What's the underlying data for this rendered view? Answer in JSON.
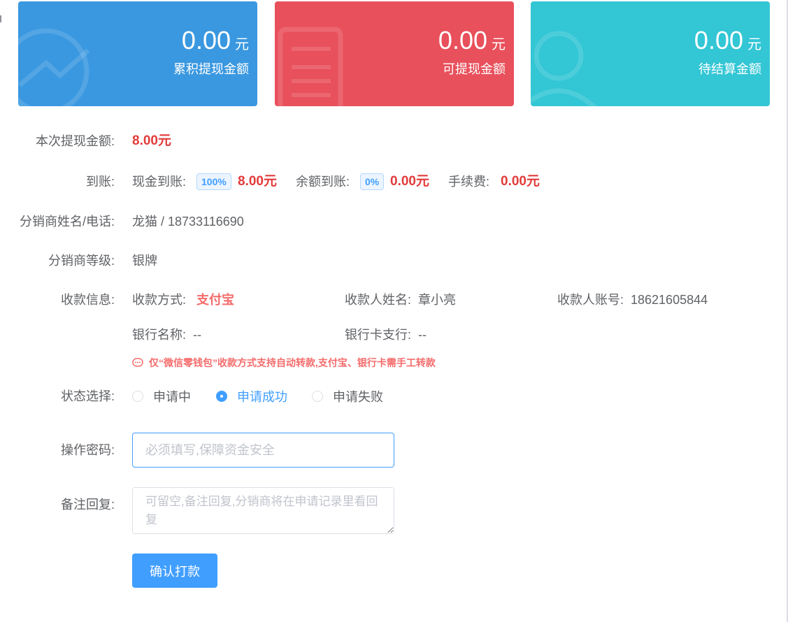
{
  "colors": {
    "card_blue": "#3a98e0",
    "card_red": "#e8505b",
    "card_cyan": "#33c6d5",
    "accent": "#409eff",
    "danger": "#e23b3b"
  },
  "stats": [
    {
      "amount": "0.00",
      "unit": "元",
      "label": "累积提现金额",
      "icon": "chart-trend-icon"
    },
    {
      "amount": "0.00",
      "unit": "元",
      "label": "可提现金额",
      "icon": "document-icon"
    },
    {
      "amount": "0.00",
      "unit": "元",
      "label": "待结算金额",
      "icon": "user-icon"
    }
  ],
  "form": {
    "amount": {
      "label": "本次提现金额:",
      "value": "8.00元"
    },
    "arrival": {
      "label": "到账:",
      "cash_label": "现金到账:",
      "cash_pct": "100%",
      "cash_value": "8.00元",
      "balance_label": "余额到账:",
      "balance_pct": "0%",
      "balance_value": "0.00元",
      "fee_label": "手续费:",
      "fee_value": "0.00元"
    },
    "distributor": {
      "label": "分销商姓名/电话:",
      "value": "龙猫 / 18733116690"
    },
    "level": {
      "label": "分销商等级:",
      "value": "银牌"
    },
    "payee": {
      "label": "收款信息:",
      "method_label": "收款方式:",
      "method_value": "支付宝",
      "name_label": "收款人姓名:",
      "name_value": "章小亮",
      "account_label": "收款人账号:",
      "account_value": "18621605844",
      "bank_label": "银行名称:",
      "bank_value": "--",
      "branch_label": "银行卡支行:",
      "branch_value": "--",
      "notice": "仅“微信零钱包”收款方式支持自动转款,支付宝、银行卡需手工转款"
    },
    "status": {
      "label": "状态选择:",
      "options": [
        "申请中",
        "申请成功",
        "申请失败"
      ],
      "selected": "申请成功"
    },
    "password": {
      "label": "操作密码:",
      "placeholder": "必须填写,保障资金安全",
      "value": ""
    },
    "remark": {
      "label": "备注回复:",
      "placeholder": "可留空,备注回复,分销商将在申请记录里看回复",
      "value": ""
    },
    "submit_label": "确认打款"
  }
}
